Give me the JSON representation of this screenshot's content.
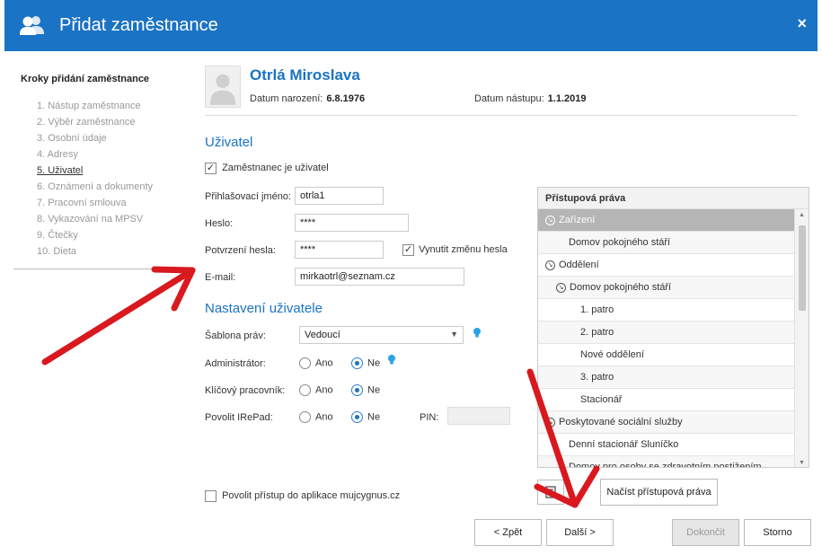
{
  "window": {
    "title": "Přidat zaměstnance",
    "close": "×"
  },
  "steps": {
    "title": "Kroky přidání zaměstnance",
    "items": [
      "1. Nástup zaměstnance",
      "2. Výběr zaměstnance",
      "3. Osobní údaje",
      "4. Adresy",
      "5. Uživatel",
      "6. Oznámení a dokumenty",
      "7. Pracovní smlouva",
      "8. Vykazování na MPSV",
      "9. Čtečky",
      "10. Dieta"
    ],
    "active_index": 4
  },
  "employee": {
    "name": "Otrlá Miroslava",
    "birth_label": "Datum narození:",
    "birth_value": "6.8.1976",
    "start_label": "Datum nástupu:",
    "start_value": "1.1.2019"
  },
  "user": {
    "section": "Uživatel",
    "is_user_label": "Zaměstnanec je uživatel",
    "is_user_checked": true,
    "login_label": "Přihlašovací jméno:",
    "login_value": "otrla1",
    "password_label": "Heslo:",
    "password_value": "****",
    "confirm_label": "Potvrzení hesla:",
    "confirm_value": "****",
    "force_change_label": "Vynutit změnu hesla",
    "force_change_checked": true,
    "email_label": "E-mail:",
    "email_value": "mirkaotrl@seznam.cz"
  },
  "settings": {
    "section": "Nastavení uživatele",
    "template_label": "Šablona práv:",
    "template_value": "Vedoucí",
    "admin_label": "Administrátor:",
    "key_worker_label": "Klíčový pracovník:",
    "irepad_label": "Povolit IRePad:",
    "yes": "Ano",
    "no": "Ne",
    "pin_label": "PIN:",
    "pin_value": "",
    "mujcygnus_label": "Povolit přístup do aplikace mujcygnus.cz",
    "mujcygnus_checked": false
  },
  "rights": {
    "header": "Přístupová práva",
    "rows": [
      {
        "label": "Zařízení",
        "level": 0,
        "toggle": true,
        "selected": true
      },
      {
        "label": "Domov pokojného stáří",
        "level": 1,
        "toggle": false
      },
      {
        "label": "Oddělení",
        "level": 0,
        "toggle": true
      },
      {
        "label": "Domov pokojného stáří",
        "level": 2,
        "toggle": true
      },
      {
        "label": "1. patro",
        "level": 3,
        "toggle": false
      },
      {
        "label": "2. patro",
        "level": 3,
        "toggle": false
      },
      {
        "label": "Nové oddělení",
        "level": 3,
        "toggle": false
      },
      {
        "label": "3. patro",
        "level": 3,
        "toggle": false
      },
      {
        "label": "Stacionář",
        "level": 3,
        "toggle": false
      },
      {
        "label": "Poskytované sociální služby",
        "level": 0,
        "toggle": true
      },
      {
        "label": "Denní stacionář Sluníčko",
        "level": 1,
        "toggle": false
      },
      {
        "label": "Domov pro osoby se zdravotním postižením",
        "level": 1,
        "toggle": false
      }
    ],
    "load_button": "Načíst přístupová práva"
  },
  "footer": {
    "back": "< Zpět",
    "next": "Další >",
    "finish": "Dokončit",
    "cancel": "Storno"
  },
  "colors": {
    "accent": "#1a73c4",
    "annotation_arrow": "#d8191f",
    "selected_row": "#b5b5b5"
  }
}
